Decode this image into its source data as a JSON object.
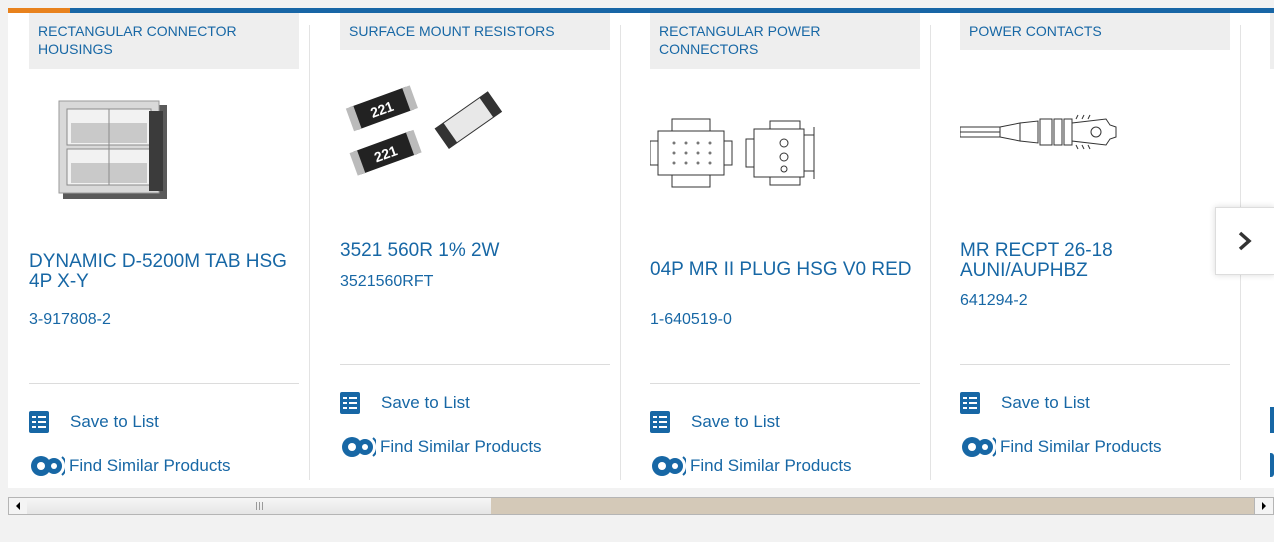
{
  "colors": {
    "accent": "#1767a5",
    "orange": "#e8821d",
    "category_bg": "#eeeeee"
  },
  "cards": [
    {
      "category": "RECTANGULAR CONNECTOR HOUSINGS",
      "name": "DYNAMIC D-5200M TAB HSG 4P X-Y",
      "part_number": "3-917808-2",
      "image_icon": "connector-housing-image",
      "save_label": "Save to List",
      "similar_label": "Find Similar Products"
    },
    {
      "category": "SURFACE MOUNT RESISTORS",
      "name": "3521 560R 1% 2W",
      "part_number": "3521560RFT",
      "image_icon": "resistor-image",
      "image_text": "221",
      "save_label": "Save to List",
      "similar_label": "Find Similar Products"
    },
    {
      "category": "RECTANGULAR POWER CONNECTORS",
      "name": "04P MR II PLUG HSG V0 RED",
      "part_number": "1-640519-0",
      "image_icon": "power-connector-image",
      "save_label": "Save to List",
      "similar_label": "Find Similar Products"
    },
    {
      "category": "POWER CONTACTS",
      "name": "MR RECPT 26-18 AUNI/AUPHBZ",
      "part_number": "641294-2",
      "image_icon": "power-contact-image",
      "save_label": "Save to List",
      "similar_label": "Find Similar Products"
    }
  ],
  "next_button_icon": "chevron-right-icon",
  "scrollbar": {
    "left_icon": "scroll-left-arrow-icon",
    "right_icon": "scroll-right-arrow-icon"
  }
}
